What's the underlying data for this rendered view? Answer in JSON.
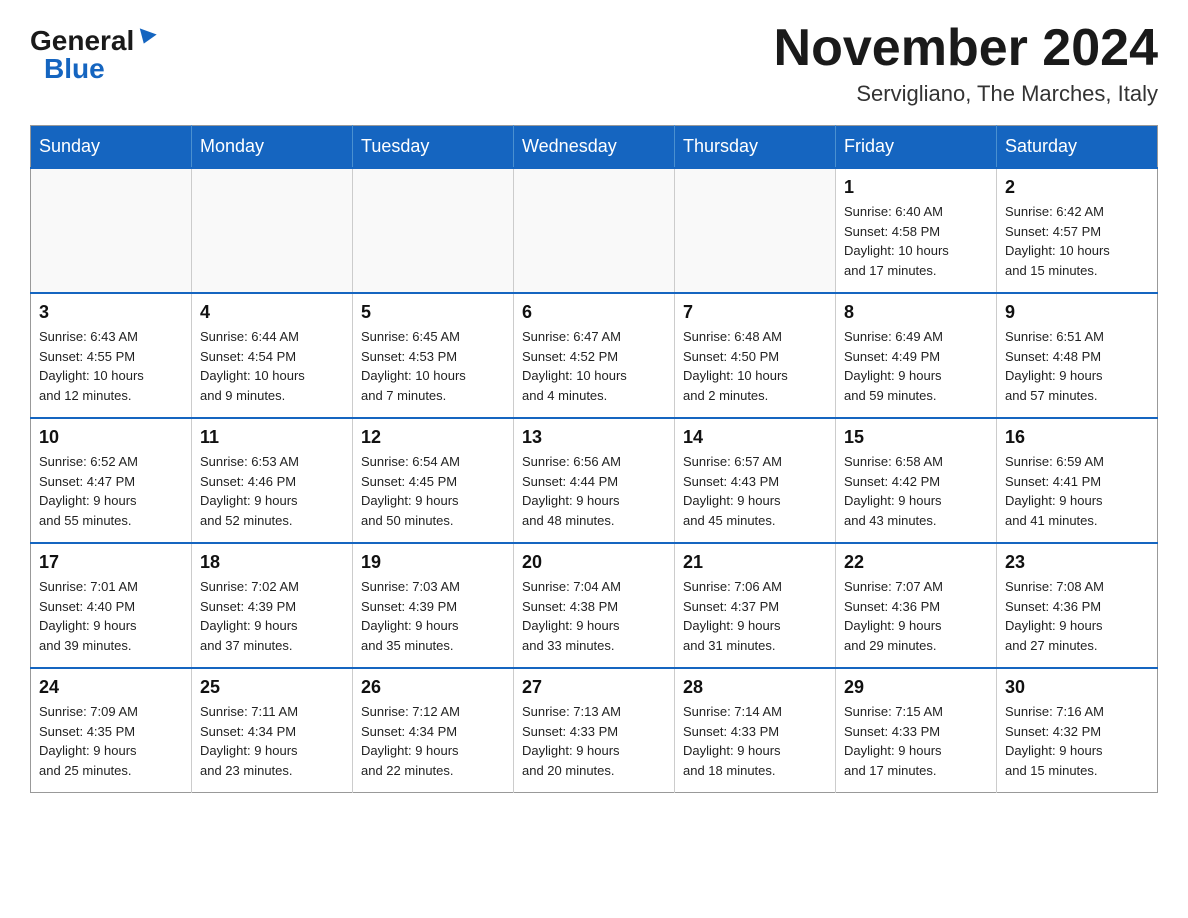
{
  "header": {
    "logo_general": "General",
    "logo_blue": "Blue",
    "title": "November 2024",
    "subtitle": "Servigliano, The Marches, Italy"
  },
  "days_of_week": [
    "Sunday",
    "Monday",
    "Tuesday",
    "Wednesday",
    "Thursday",
    "Friday",
    "Saturday"
  ],
  "weeks": [
    [
      {
        "day": "",
        "info": ""
      },
      {
        "day": "",
        "info": ""
      },
      {
        "day": "",
        "info": ""
      },
      {
        "day": "",
        "info": ""
      },
      {
        "day": "",
        "info": ""
      },
      {
        "day": "1",
        "info": "Sunrise: 6:40 AM\nSunset: 4:58 PM\nDaylight: 10 hours\nand 17 minutes."
      },
      {
        "day": "2",
        "info": "Sunrise: 6:42 AM\nSunset: 4:57 PM\nDaylight: 10 hours\nand 15 minutes."
      }
    ],
    [
      {
        "day": "3",
        "info": "Sunrise: 6:43 AM\nSunset: 4:55 PM\nDaylight: 10 hours\nand 12 minutes."
      },
      {
        "day": "4",
        "info": "Sunrise: 6:44 AM\nSunset: 4:54 PM\nDaylight: 10 hours\nand 9 minutes."
      },
      {
        "day": "5",
        "info": "Sunrise: 6:45 AM\nSunset: 4:53 PM\nDaylight: 10 hours\nand 7 minutes."
      },
      {
        "day": "6",
        "info": "Sunrise: 6:47 AM\nSunset: 4:52 PM\nDaylight: 10 hours\nand 4 minutes."
      },
      {
        "day": "7",
        "info": "Sunrise: 6:48 AM\nSunset: 4:50 PM\nDaylight: 10 hours\nand 2 minutes."
      },
      {
        "day": "8",
        "info": "Sunrise: 6:49 AM\nSunset: 4:49 PM\nDaylight: 9 hours\nand 59 minutes."
      },
      {
        "day": "9",
        "info": "Sunrise: 6:51 AM\nSunset: 4:48 PM\nDaylight: 9 hours\nand 57 minutes."
      }
    ],
    [
      {
        "day": "10",
        "info": "Sunrise: 6:52 AM\nSunset: 4:47 PM\nDaylight: 9 hours\nand 55 minutes."
      },
      {
        "day": "11",
        "info": "Sunrise: 6:53 AM\nSunset: 4:46 PM\nDaylight: 9 hours\nand 52 minutes."
      },
      {
        "day": "12",
        "info": "Sunrise: 6:54 AM\nSunset: 4:45 PM\nDaylight: 9 hours\nand 50 minutes."
      },
      {
        "day": "13",
        "info": "Sunrise: 6:56 AM\nSunset: 4:44 PM\nDaylight: 9 hours\nand 48 minutes."
      },
      {
        "day": "14",
        "info": "Sunrise: 6:57 AM\nSunset: 4:43 PM\nDaylight: 9 hours\nand 45 minutes."
      },
      {
        "day": "15",
        "info": "Sunrise: 6:58 AM\nSunset: 4:42 PM\nDaylight: 9 hours\nand 43 minutes."
      },
      {
        "day": "16",
        "info": "Sunrise: 6:59 AM\nSunset: 4:41 PM\nDaylight: 9 hours\nand 41 minutes."
      }
    ],
    [
      {
        "day": "17",
        "info": "Sunrise: 7:01 AM\nSunset: 4:40 PM\nDaylight: 9 hours\nand 39 minutes."
      },
      {
        "day": "18",
        "info": "Sunrise: 7:02 AM\nSunset: 4:39 PM\nDaylight: 9 hours\nand 37 minutes."
      },
      {
        "day": "19",
        "info": "Sunrise: 7:03 AM\nSunset: 4:39 PM\nDaylight: 9 hours\nand 35 minutes."
      },
      {
        "day": "20",
        "info": "Sunrise: 7:04 AM\nSunset: 4:38 PM\nDaylight: 9 hours\nand 33 minutes."
      },
      {
        "day": "21",
        "info": "Sunrise: 7:06 AM\nSunset: 4:37 PM\nDaylight: 9 hours\nand 31 minutes."
      },
      {
        "day": "22",
        "info": "Sunrise: 7:07 AM\nSunset: 4:36 PM\nDaylight: 9 hours\nand 29 minutes."
      },
      {
        "day": "23",
        "info": "Sunrise: 7:08 AM\nSunset: 4:36 PM\nDaylight: 9 hours\nand 27 minutes."
      }
    ],
    [
      {
        "day": "24",
        "info": "Sunrise: 7:09 AM\nSunset: 4:35 PM\nDaylight: 9 hours\nand 25 minutes."
      },
      {
        "day": "25",
        "info": "Sunrise: 7:11 AM\nSunset: 4:34 PM\nDaylight: 9 hours\nand 23 minutes."
      },
      {
        "day": "26",
        "info": "Sunrise: 7:12 AM\nSunset: 4:34 PM\nDaylight: 9 hours\nand 22 minutes."
      },
      {
        "day": "27",
        "info": "Sunrise: 7:13 AM\nSunset: 4:33 PM\nDaylight: 9 hours\nand 20 minutes."
      },
      {
        "day": "28",
        "info": "Sunrise: 7:14 AM\nSunset: 4:33 PM\nDaylight: 9 hours\nand 18 minutes."
      },
      {
        "day": "29",
        "info": "Sunrise: 7:15 AM\nSunset: 4:33 PM\nDaylight: 9 hours\nand 17 minutes."
      },
      {
        "day": "30",
        "info": "Sunrise: 7:16 AM\nSunset: 4:32 PM\nDaylight: 9 hours\nand 15 minutes."
      }
    ]
  ]
}
